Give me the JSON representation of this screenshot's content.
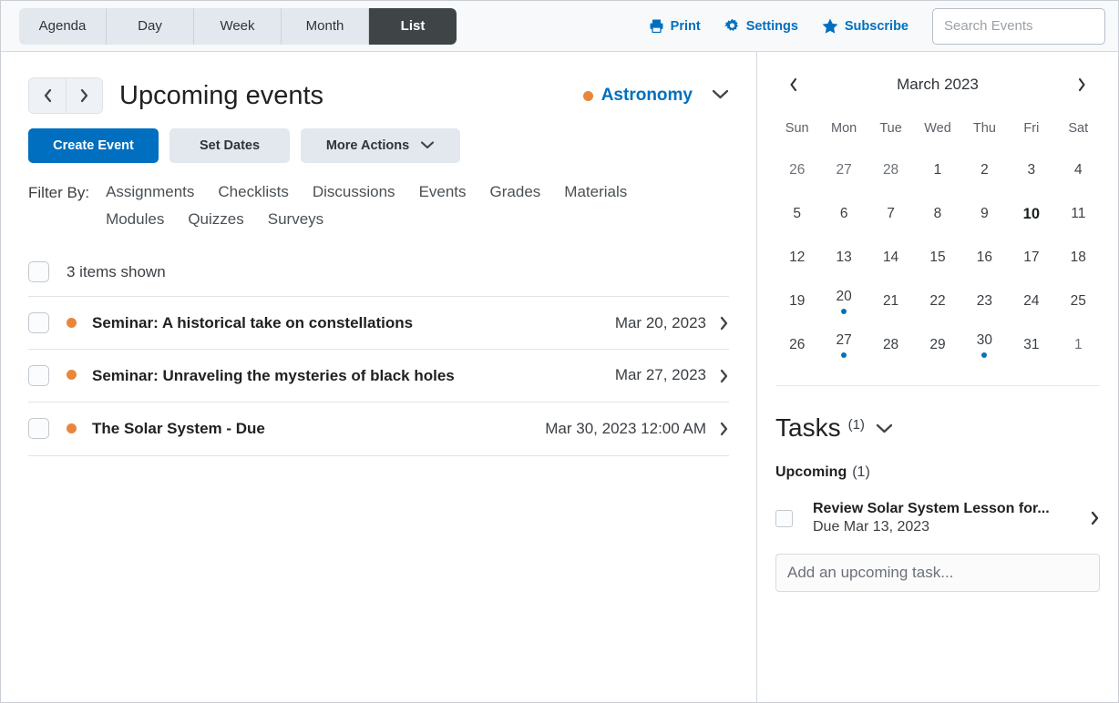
{
  "topbar": {
    "view_tabs": [
      {
        "label": "Agenda",
        "active": false
      },
      {
        "label": "Day",
        "active": false
      },
      {
        "label": "Week",
        "active": false
      },
      {
        "label": "Month",
        "active": false
      },
      {
        "label": "List",
        "active": true
      }
    ],
    "tools": [
      {
        "label": "Print",
        "icon": "printer-icon"
      },
      {
        "label": "Settings",
        "icon": "gear-icon"
      },
      {
        "label": "Subscribe",
        "icon": "star-icon"
      }
    ],
    "search": {
      "value": "",
      "placeholder": "Search Events",
      "icon": "search-icon"
    }
  },
  "main": {
    "prev_label": "‹",
    "next_label": "›",
    "page_title": "Upcoming events",
    "calendar_selector": {
      "label": "Astronomy",
      "dot_color": "#e8873c"
    },
    "actions": {
      "create_event": "Create Event",
      "set_dates": "Set Dates",
      "more_actions": "More Actions"
    },
    "filter": {
      "label": "Filter By:",
      "options": [
        "Assignments",
        "Checklists",
        "Discussions",
        "Events",
        "Grades",
        "Materials",
        "Modules",
        "Quizzes",
        "Surveys"
      ]
    },
    "list": {
      "items_shown": "3 items shown",
      "rows": [
        {
          "title": "Seminar: A historical take on constellations",
          "date": "Mar 20, 2023",
          "dot_color": "#e8873c"
        },
        {
          "title": "Seminar: Unraveling the mysteries of black holes",
          "date": "Mar 27, 2023",
          "dot_color": "#e8873c"
        },
        {
          "title": "The Solar System - Due",
          "date": "Mar 30, 2023 12:00 AM",
          "dot_color": "#e8873c"
        }
      ]
    }
  },
  "sidebar": {
    "mini_calendar": {
      "title": "March 2023",
      "prev_label": "‹",
      "next_label": "›",
      "weekdays": [
        "Sun",
        "Mon",
        "Tue",
        "Wed",
        "Thu",
        "Fri",
        "Sat"
      ],
      "weeks": [
        [
          {
            "d": "26",
            "other": true
          },
          {
            "d": "27",
            "other": true
          },
          {
            "d": "28",
            "other": true
          },
          {
            "d": "1"
          },
          {
            "d": "2"
          },
          {
            "d": "3"
          },
          {
            "d": "4"
          }
        ],
        [
          {
            "d": "5"
          },
          {
            "d": "6"
          },
          {
            "d": "7"
          },
          {
            "d": "8"
          },
          {
            "d": "9"
          },
          {
            "d": "10",
            "today": true
          },
          {
            "d": "11"
          }
        ],
        [
          {
            "d": "12"
          },
          {
            "d": "13"
          },
          {
            "d": "14"
          },
          {
            "d": "15"
          },
          {
            "d": "16"
          },
          {
            "d": "17"
          },
          {
            "d": "18"
          }
        ],
        [
          {
            "d": "19"
          },
          {
            "d": "20",
            "event": true
          },
          {
            "d": "21"
          },
          {
            "d": "22"
          },
          {
            "d": "23"
          },
          {
            "d": "24"
          },
          {
            "d": "25"
          }
        ],
        [
          {
            "d": "26"
          },
          {
            "d": "27",
            "event": true
          },
          {
            "d": "28"
          },
          {
            "d": "29"
          },
          {
            "d": "30",
            "event": true
          },
          {
            "d": "31"
          },
          {
            "d": "1",
            "other": true
          }
        ]
      ],
      "event_dot_color": "#0a70b8"
    },
    "tasks": {
      "title": "Tasks",
      "count": "(1)",
      "upcoming_label": "Upcoming",
      "upcoming_count": "(1)",
      "items": [
        {
          "name": "Review Solar System Lesson for...",
          "due": "Due Mar 13, 2023"
        }
      ],
      "add_placeholder": "Add an upcoming task...",
      "add_value": ""
    }
  },
  "colors": {
    "accent_blue": "#006fbf",
    "orange": "#e8873c",
    "tab_active": "#3f4547"
  }
}
